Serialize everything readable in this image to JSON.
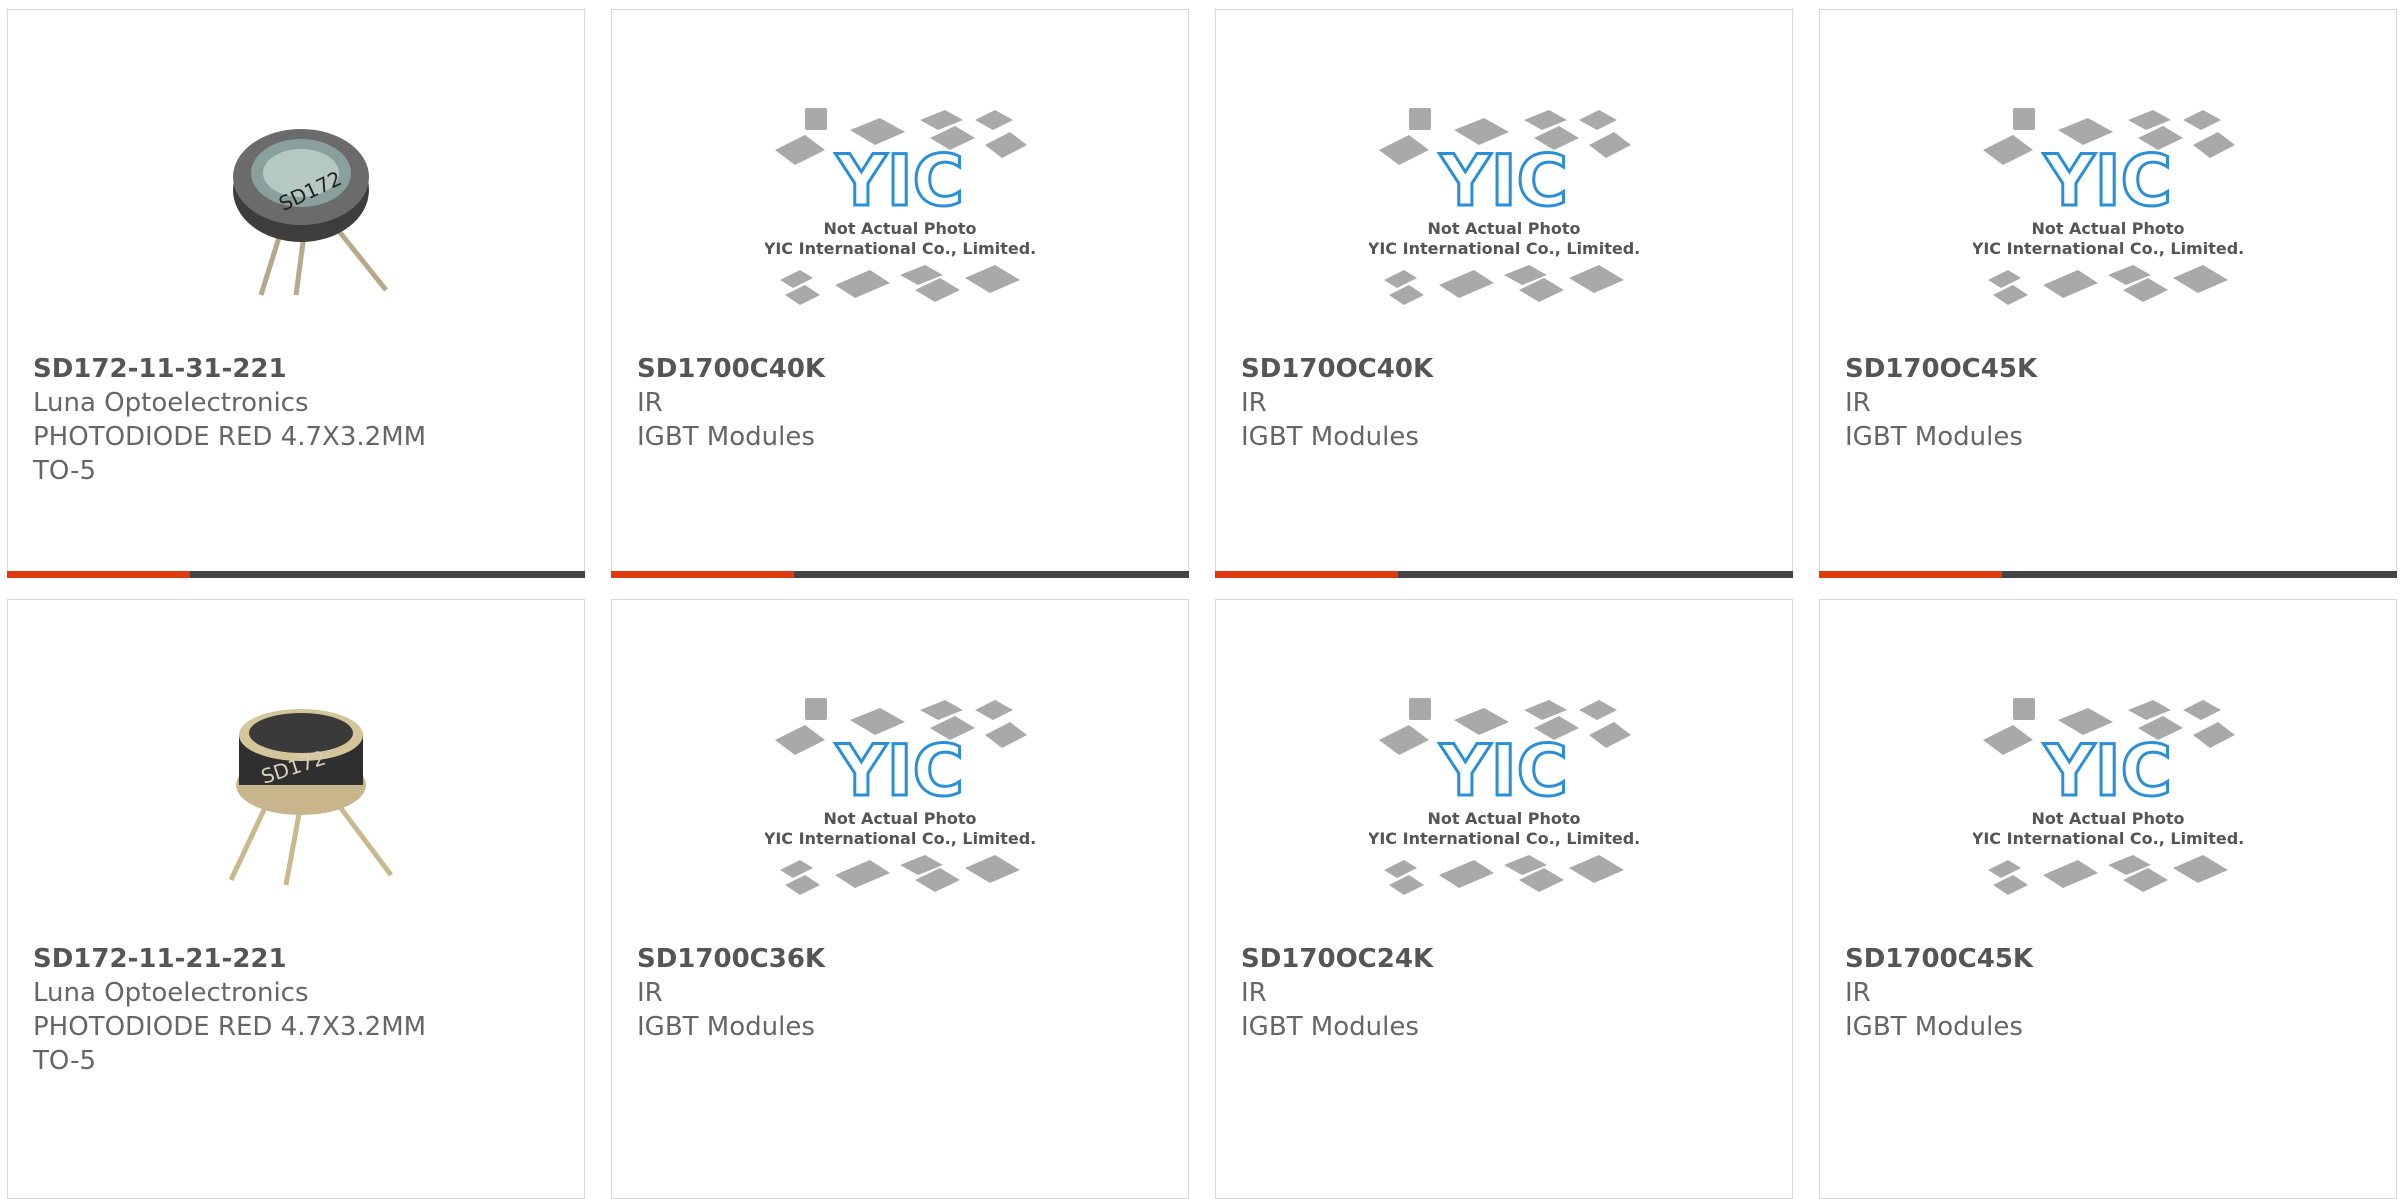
{
  "placeholder_image": {
    "line1": "Not Actual Photo",
    "line2": "YIC International Co., Limited."
  },
  "colors": {
    "accent": "#e03a12",
    "bar": "#444444",
    "logo_blue": "#2a8fd6",
    "logo_dark": "#1d3d8a"
  },
  "products": [
    {
      "part": "SD172-11-31-221",
      "maker": "Luna Optoelectronics",
      "desc": "PHOTODIODE RED 4.7X3.2MM",
      "pkg": "TO-5",
      "image": "to5-photodiode-icon"
    },
    {
      "part": "SD1700C40K",
      "maker": "IR",
      "desc": "IGBT Modules",
      "pkg": "",
      "image": "yic-placeholder"
    },
    {
      "part": "SD170OC40K",
      "maker": "IR",
      "desc": "IGBT Modules",
      "pkg": "",
      "image": "yic-placeholder"
    },
    {
      "part": "SD170OC45K",
      "maker": "IR",
      "desc": "IGBT Modules",
      "pkg": "",
      "image": "yic-placeholder"
    },
    {
      "part": "SD172-11-21-221",
      "maker": "Luna Optoelectronics",
      "desc": "PHOTODIODE RED 4.7X3.2MM",
      "pkg": "TO-5",
      "image": "to5-photodiode-icon"
    },
    {
      "part": "SD1700C36K",
      "maker": "IR",
      "desc": "IGBT Modules",
      "pkg": "",
      "image": "yic-placeholder"
    },
    {
      "part": "SD170OC24K",
      "maker": "IR",
      "desc": "IGBT Modules",
      "pkg": "",
      "image": "yic-placeholder"
    },
    {
      "part": "SD1700C45K",
      "maker": "IR",
      "desc": "IGBT Modules",
      "pkg": "",
      "image": "yic-placeholder"
    }
  ]
}
